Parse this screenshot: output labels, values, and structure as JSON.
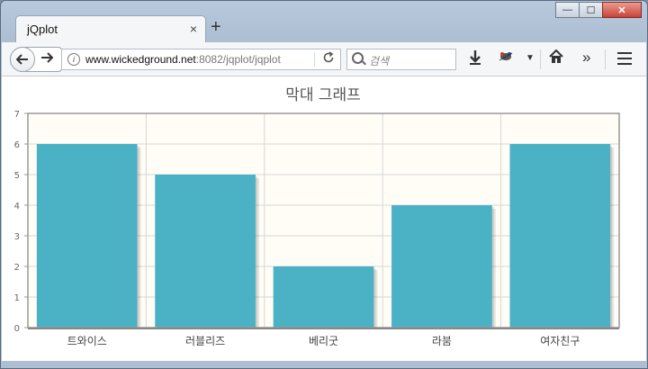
{
  "window": {
    "tab_title": "jQplot",
    "close_tab_glyph": "×",
    "new_tab_glyph": "+",
    "minimize_glyph": "—",
    "maximize_glyph": "☐",
    "close_glyph": "✕"
  },
  "navbar": {
    "url_host": "www.wickedground.net",
    "url_path": ":8082/jqplot/jqplot",
    "search_placeholder": "검색",
    "icons": [
      "back-icon",
      "forward-icon",
      "info-icon",
      "reload-icon",
      "search-icon",
      "download-icon",
      "extension-icon",
      "dropdown-icon",
      "home-icon",
      "overflow-icon",
      "menu-icon"
    ]
  },
  "chart_data": {
    "type": "bar",
    "title": "막대 그래프",
    "categories": [
      "트와이스",
      "러블리즈",
      "베리굿",
      "라붐",
      "여자친구"
    ],
    "values": [
      6,
      5,
      2,
      4,
      6
    ],
    "ylim": [
      0,
      7
    ],
    "yticks": [
      "0",
      "1",
      "2",
      "3",
      "4",
      "5",
      "6",
      "7"
    ],
    "grid": true,
    "bar_color": "#4bb2c5",
    "plot_bg": "#fffdf6"
  }
}
